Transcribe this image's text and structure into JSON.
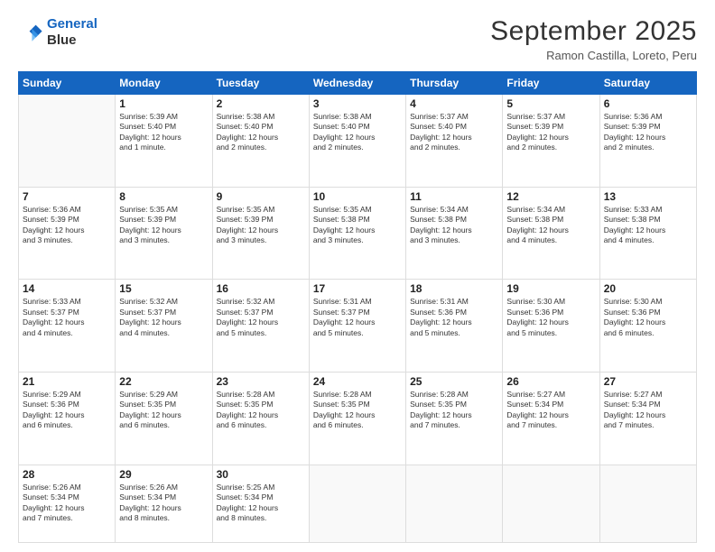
{
  "header": {
    "logo_line1": "General",
    "logo_line2": "Blue",
    "month_title": "September 2025",
    "subtitle": "Ramon Castilla, Loreto, Peru"
  },
  "days_of_week": [
    "Sunday",
    "Monday",
    "Tuesday",
    "Wednesday",
    "Thursday",
    "Friday",
    "Saturday"
  ],
  "weeks": [
    [
      {
        "day": "",
        "text": ""
      },
      {
        "day": "1",
        "text": "Sunrise: 5:39 AM\nSunset: 5:40 PM\nDaylight: 12 hours\nand 1 minute."
      },
      {
        "day": "2",
        "text": "Sunrise: 5:38 AM\nSunset: 5:40 PM\nDaylight: 12 hours\nand 2 minutes."
      },
      {
        "day": "3",
        "text": "Sunrise: 5:38 AM\nSunset: 5:40 PM\nDaylight: 12 hours\nand 2 minutes."
      },
      {
        "day": "4",
        "text": "Sunrise: 5:37 AM\nSunset: 5:40 PM\nDaylight: 12 hours\nand 2 minutes."
      },
      {
        "day": "5",
        "text": "Sunrise: 5:37 AM\nSunset: 5:39 PM\nDaylight: 12 hours\nand 2 minutes."
      },
      {
        "day": "6",
        "text": "Sunrise: 5:36 AM\nSunset: 5:39 PM\nDaylight: 12 hours\nand 2 minutes."
      }
    ],
    [
      {
        "day": "7",
        "text": "Sunrise: 5:36 AM\nSunset: 5:39 PM\nDaylight: 12 hours\nand 3 minutes."
      },
      {
        "day": "8",
        "text": "Sunrise: 5:35 AM\nSunset: 5:39 PM\nDaylight: 12 hours\nand 3 minutes."
      },
      {
        "day": "9",
        "text": "Sunrise: 5:35 AM\nSunset: 5:39 PM\nDaylight: 12 hours\nand 3 minutes."
      },
      {
        "day": "10",
        "text": "Sunrise: 5:35 AM\nSunset: 5:38 PM\nDaylight: 12 hours\nand 3 minutes."
      },
      {
        "day": "11",
        "text": "Sunrise: 5:34 AM\nSunset: 5:38 PM\nDaylight: 12 hours\nand 3 minutes."
      },
      {
        "day": "12",
        "text": "Sunrise: 5:34 AM\nSunset: 5:38 PM\nDaylight: 12 hours\nand 4 minutes."
      },
      {
        "day": "13",
        "text": "Sunrise: 5:33 AM\nSunset: 5:38 PM\nDaylight: 12 hours\nand 4 minutes."
      }
    ],
    [
      {
        "day": "14",
        "text": "Sunrise: 5:33 AM\nSunset: 5:37 PM\nDaylight: 12 hours\nand 4 minutes."
      },
      {
        "day": "15",
        "text": "Sunrise: 5:32 AM\nSunset: 5:37 PM\nDaylight: 12 hours\nand 4 minutes."
      },
      {
        "day": "16",
        "text": "Sunrise: 5:32 AM\nSunset: 5:37 PM\nDaylight: 12 hours\nand 5 minutes."
      },
      {
        "day": "17",
        "text": "Sunrise: 5:31 AM\nSunset: 5:37 PM\nDaylight: 12 hours\nand 5 minutes."
      },
      {
        "day": "18",
        "text": "Sunrise: 5:31 AM\nSunset: 5:36 PM\nDaylight: 12 hours\nand 5 minutes."
      },
      {
        "day": "19",
        "text": "Sunrise: 5:30 AM\nSunset: 5:36 PM\nDaylight: 12 hours\nand 5 minutes."
      },
      {
        "day": "20",
        "text": "Sunrise: 5:30 AM\nSunset: 5:36 PM\nDaylight: 12 hours\nand 6 minutes."
      }
    ],
    [
      {
        "day": "21",
        "text": "Sunrise: 5:29 AM\nSunset: 5:36 PM\nDaylight: 12 hours\nand 6 minutes."
      },
      {
        "day": "22",
        "text": "Sunrise: 5:29 AM\nSunset: 5:35 PM\nDaylight: 12 hours\nand 6 minutes."
      },
      {
        "day": "23",
        "text": "Sunrise: 5:28 AM\nSunset: 5:35 PM\nDaylight: 12 hours\nand 6 minutes."
      },
      {
        "day": "24",
        "text": "Sunrise: 5:28 AM\nSunset: 5:35 PM\nDaylight: 12 hours\nand 6 minutes."
      },
      {
        "day": "25",
        "text": "Sunrise: 5:28 AM\nSunset: 5:35 PM\nDaylight: 12 hours\nand 7 minutes."
      },
      {
        "day": "26",
        "text": "Sunrise: 5:27 AM\nSunset: 5:34 PM\nDaylight: 12 hours\nand 7 minutes."
      },
      {
        "day": "27",
        "text": "Sunrise: 5:27 AM\nSunset: 5:34 PM\nDaylight: 12 hours\nand 7 minutes."
      }
    ],
    [
      {
        "day": "28",
        "text": "Sunrise: 5:26 AM\nSunset: 5:34 PM\nDaylight: 12 hours\nand 7 minutes."
      },
      {
        "day": "29",
        "text": "Sunrise: 5:26 AM\nSunset: 5:34 PM\nDaylight: 12 hours\nand 8 minutes."
      },
      {
        "day": "30",
        "text": "Sunrise: 5:25 AM\nSunset: 5:34 PM\nDaylight: 12 hours\nand 8 minutes."
      },
      {
        "day": "",
        "text": ""
      },
      {
        "day": "",
        "text": ""
      },
      {
        "day": "",
        "text": ""
      },
      {
        "day": "",
        "text": ""
      }
    ]
  ]
}
